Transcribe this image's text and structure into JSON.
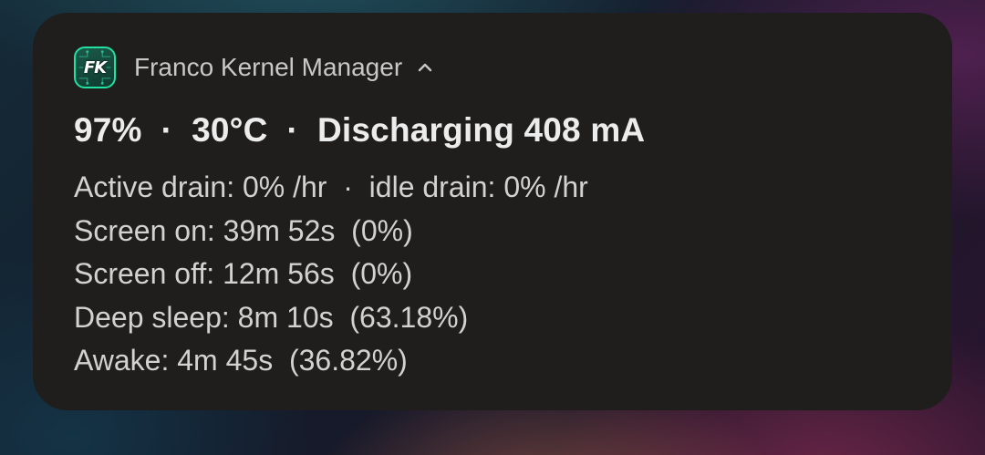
{
  "notification": {
    "app_icon_label": "FK",
    "app_name": "Franco Kernel Manager",
    "expand_icon": "chevron-up-icon",
    "title": "97%  ·  30°C  ·  Discharging 408 mA",
    "lines": [
      "Active drain: 0% /hr  ·  idle drain: 0% /hr",
      "Screen on: 39m 52s  (0%)",
      "Screen off: 12m 56s  (0%)",
      "Deep sleep: 8m 10s  (63.18%)",
      "Awake: 4m 45s  (36.82%)"
    ]
  },
  "colors": {
    "card_background": "#1f1e1d",
    "icon_accent": "#22e0a0",
    "title_text": "#ececec",
    "body_text": "#d2d2d2"
  }
}
